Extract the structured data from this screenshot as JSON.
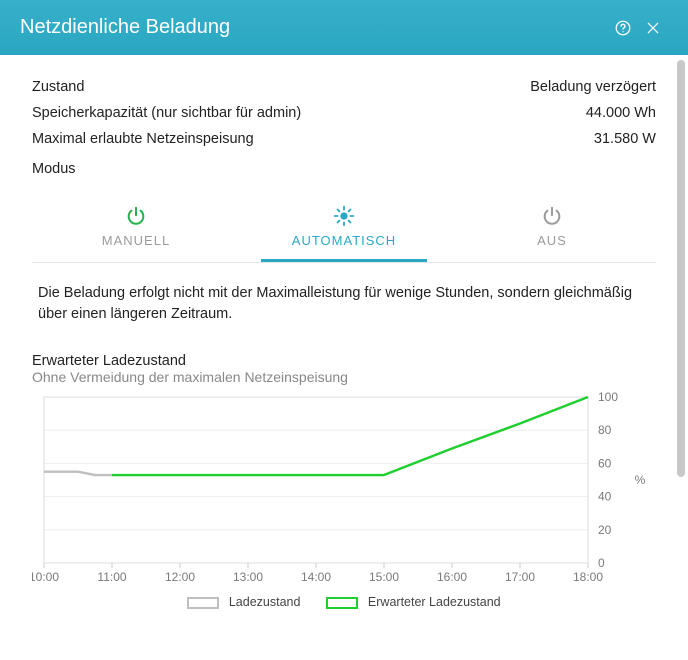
{
  "header": {
    "title": "Netzdienliche Beladung"
  },
  "status": {
    "state_label": "Zustand",
    "state_value": "Beladung verzögert",
    "capacity_label": "Speicherkapazität (nur sichtbar für admin)",
    "capacity_value": "44.000 Wh",
    "feedin_label": "Maximal erlaubte Netzeinspeisung",
    "feedin_value": "31.580 W"
  },
  "mode": {
    "label": "Modus",
    "tabs": [
      {
        "label": "MANUELL",
        "icon": "power-icon",
        "active": false,
        "color": "#26b14c"
      },
      {
        "label": "AUTOMATISCH",
        "icon": "sun-icon",
        "active": true,
        "color": "#2aa9c6"
      },
      {
        "label": "AUS",
        "icon": "power-icon",
        "active": false,
        "color": "#9b9b9b"
      }
    ]
  },
  "description": "Die Beladung erfolgt nicht mit der Maximalleistung für wenige Stunden, sondern gleichmäßig über einen längeren Zeitraum.",
  "chart": {
    "title": "Erwarteter Ladezustand",
    "subtitle": "Ohne Vermeidung der maximalen Netzeinspeisung",
    "ylabel": "%",
    "legend": [
      {
        "label": "Ladezustand",
        "color": "#bfbfbf"
      },
      {
        "label": "Erwarteter Ladezustand",
        "color": "#1fce2f"
      }
    ]
  },
  "chart_data": {
    "type": "line",
    "xlabel": "",
    "ylabel": "%",
    "ylim": [
      0,
      100
    ],
    "x_ticks": [
      "10:00",
      "11:00",
      "12:00",
      "13:00",
      "14:00",
      "15:00",
      "16:00",
      "17:00",
      "18:00"
    ],
    "y_ticks": [
      0,
      20,
      40,
      60,
      80,
      100
    ],
    "series": [
      {
        "name": "Ladezustand",
        "color": "#bfbfbf",
        "x": [
          "10:00",
          "10:30",
          "10:45",
          "11:00"
        ],
        "y": [
          55,
          55,
          53,
          53
        ]
      },
      {
        "name": "Erwarteter Ladezustand",
        "color": "#1fce2f",
        "x": [
          "11:00",
          "12:00",
          "13:00",
          "14:00",
          "15:00",
          "16:00",
          "17:00",
          "18:00"
        ],
        "y": [
          53,
          53,
          53,
          53,
          53,
          69,
          84,
          100
        ]
      }
    ]
  }
}
